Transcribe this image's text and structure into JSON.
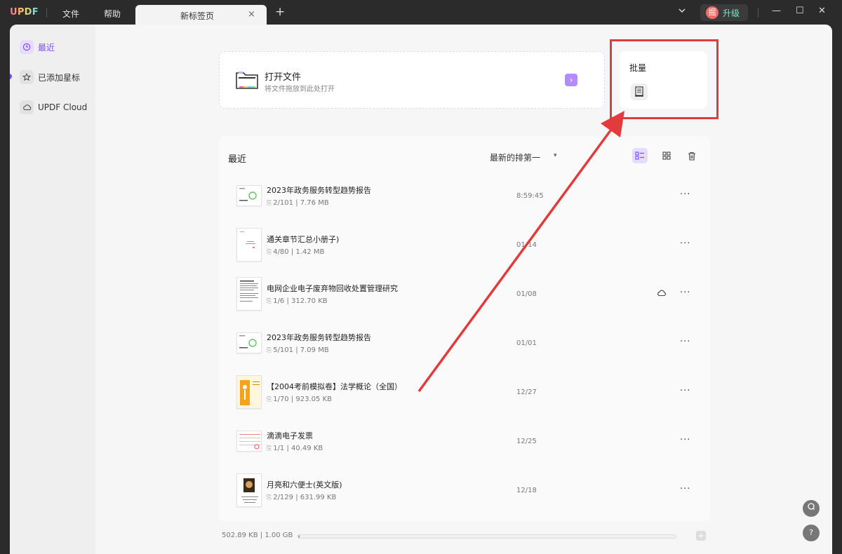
{
  "titlebar": {
    "logo": "UPDF",
    "menus": [
      "文件",
      "帮助"
    ],
    "tab_label": "新标签页",
    "tab_close": "×",
    "tab_add": "+",
    "upgrade_badge": "掘",
    "upgrade_label": "升级",
    "window_controls": {
      "minimize": "—",
      "maximize": "☐",
      "close": "✕"
    }
  },
  "sidebar": {
    "items": [
      {
        "label": "最近",
        "icon": "clock-icon",
        "active": true
      },
      {
        "label": "已添加星标",
        "icon": "star-icon",
        "active": false
      },
      {
        "label": "UPDF Cloud",
        "icon": "cloud-icon",
        "active": false
      }
    ]
  },
  "open_file": {
    "title": "打开文件",
    "subtitle": "将文件拖放到此处打开",
    "arrow": "›"
  },
  "batch": {
    "title": "批量"
  },
  "recent": {
    "title": "最近",
    "sort_label": "最新的排第一",
    "sort_arrow": "▾",
    "files": [
      {
        "name": "2023年政务服务转型趋势报告",
        "pages": "2/101",
        "size": "7.76 MB",
        "date": "8:59:45",
        "cloud": false
      },
      {
        "name": "通关章节汇总小册子)",
        "pages": "4/80",
        "size": "1.42 MB",
        "date": "01/14",
        "cloud": false
      },
      {
        "name": "电网企业电子废弃物回收处置管理研究",
        "pages": "1/6",
        "size": "312.70 KB",
        "date": "01/08",
        "cloud": true
      },
      {
        "name": "2023年政务服务转型趋势报告",
        "pages": "5/101",
        "size": "7.09 MB",
        "date": "01/01",
        "cloud": false
      },
      {
        "name": "【2004考前模拟卷】法学概论（全国）",
        "pages": "1/70",
        "size": "923.05 KB",
        "date": "12/27",
        "cloud": false
      },
      {
        "name": "滴滴电子发票",
        "pages": "1/1",
        "size": "40.49 KB",
        "date": "12/25",
        "cloud": false
      },
      {
        "name": "月亮和六便士(英文版)",
        "pages": "2/129",
        "size": "631.99 KB",
        "date": "12/18",
        "cloud": false
      }
    ]
  },
  "storage": {
    "text": "502.89 KB | 1.00 GB",
    "used_fraction": 0.0005,
    "plus": "+"
  },
  "fabs": {
    "search": "⌕",
    "help": "?"
  },
  "colors": {
    "accent": "#7b4dff",
    "accent_light": "#e6dcff",
    "annotation_red": "#e33b3b",
    "titlebar_bg": "#2b2b2b"
  }
}
